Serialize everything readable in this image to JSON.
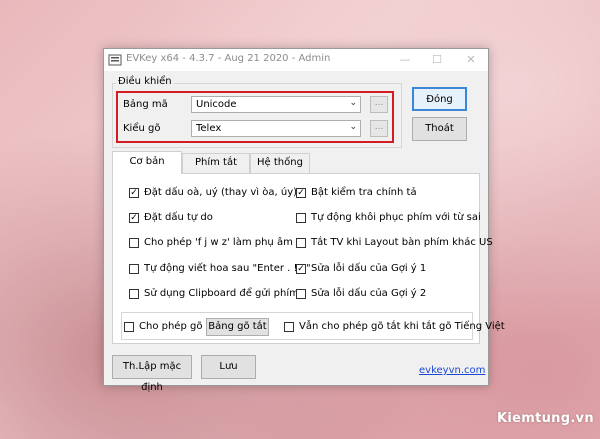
{
  "window": {
    "title": "EVKey x64 - 4.3.7 - Aug 21 2020 - Admin",
    "controls": {
      "minimize": "—",
      "maximize": "☐",
      "close": "✕"
    }
  },
  "control_group": {
    "label": "Điều khiển",
    "bang_ma": {
      "label": "Bảng mã",
      "value": "Unicode",
      "more": "..."
    },
    "kieu_go": {
      "label": "Kiểu gõ",
      "value": "Telex",
      "more": "..."
    }
  },
  "buttons": {
    "dong": "Đóng",
    "thoat": "Thoát",
    "bang_go_tat": "Bảng gõ tắt",
    "th_lap": "Th.Lập mặc định",
    "luu": "Lưu"
  },
  "tabs": [
    {
      "label": "Cơ bản",
      "active": true
    },
    {
      "label": "Phím tắt",
      "active": false
    },
    {
      "label": "Hệ thống",
      "active": false
    }
  ],
  "options_left": [
    {
      "label": "Đặt dấu oà, uý (thay vì òa, úy)",
      "checked": true
    },
    {
      "label": "Đặt dấu tự do",
      "checked": true
    },
    {
      "label": "Cho phép 'f j w z' làm phụ âm",
      "checked": false
    },
    {
      "label": "Tự động viết hoa sau \"Enter . ! ?\"",
      "checked": false
    },
    {
      "label": "Sử dụng Clipboard để gửi phím",
      "checked": false
    }
  ],
  "options_right": [
    {
      "label": "Bật kiểm tra chính tả",
      "checked": true
    },
    {
      "label": "Tự động khôi phục phím với từ sai",
      "checked": false
    },
    {
      "label": "Tắt TV khi Layout bàn phím khác US",
      "checked": false
    },
    {
      "label": "Sửa lỗi dấu của Gợi ý 1",
      "checked": true
    },
    {
      "label": "Sửa lỗi dấu của Gợi ý 2",
      "checked": false
    }
  ],
  "shortcut_options": {
    "allow_shortcut": {
      "label": "Cho phép gõ tắt",
      "checked": false
    },
    "keep_shortcut": {
      "label": "Vẫn cho phép gõ tắt khi tắt gõ Tiếng Việt",
      "checked": false
    }
  },
  "link": "evkeyvn.com",
  "watermark": "Kiemtung.vn",
  "colors": {
    "highlight": "#d21c22",
    "link": "#1a4ad4",
    "default_button_border": "#3c86d8"
  }
}
